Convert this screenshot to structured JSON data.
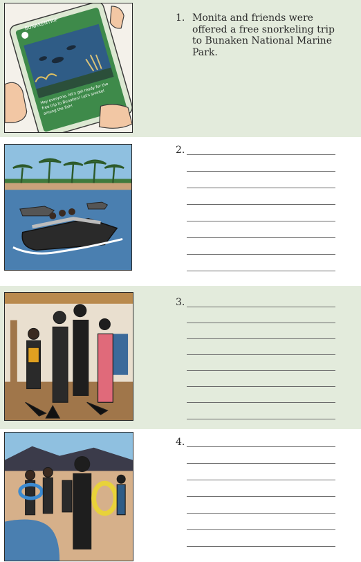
{
  "items": [
    {
      "number": "1.",
      "text": "Monita and friends were offered a free snorkeling trip to Bunaken National Marine Park."
    },
    {
      "number": "2.",
      "blank_lines": 8
    },
    {
      "number": "3.",
      "blank_lines": 8
    },
    {
      "number": "4.",
      "blank_lines": 7
    }
  ],
  "phone": {
    "app_title": "BUNAKENTRIP",
    "post_text": "Hey everyone, let's get ready for the free trip to Bunaken! Let's snorkel among the fish!"
  },
  "colors": {
    "band_green": "#e3ebdc",
    "sea_blue": "#4a7fb0",
    "sky_blue": "#8fc0e0",
    "sand": "#c9a27a"
  }
}
